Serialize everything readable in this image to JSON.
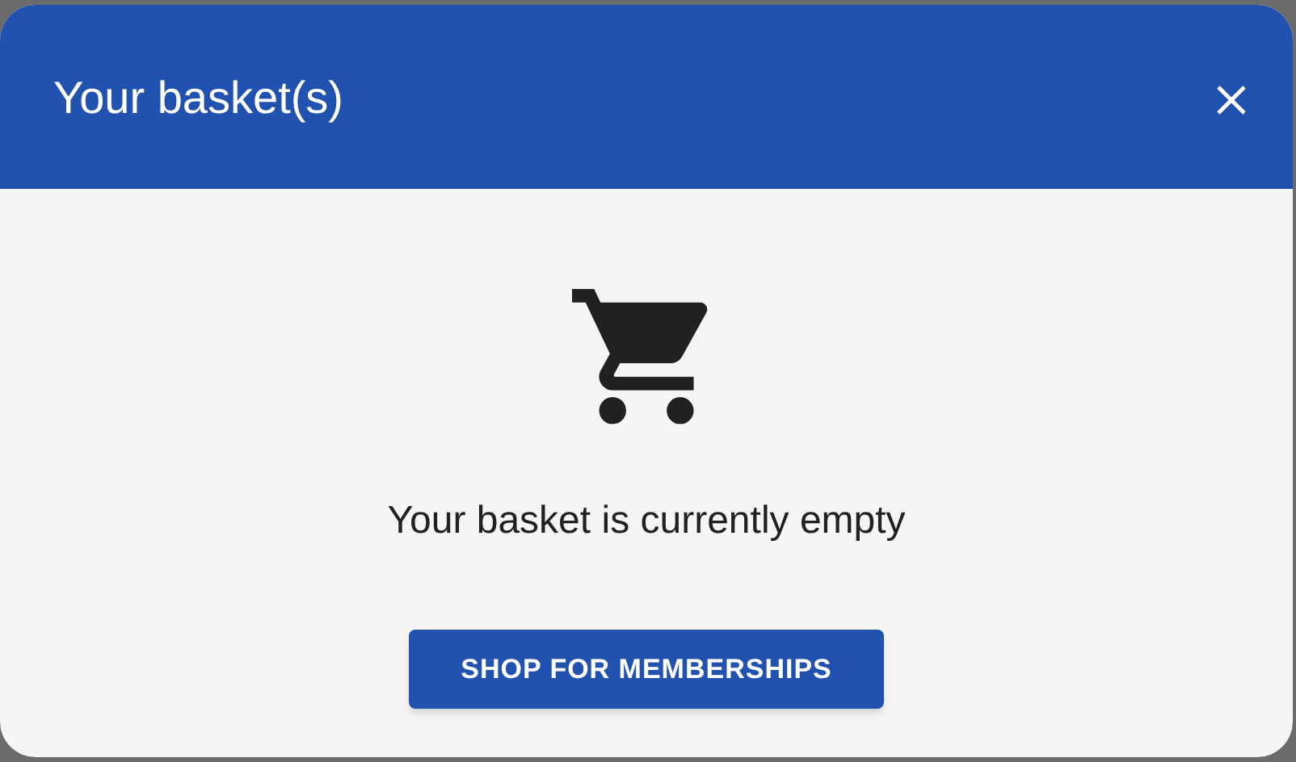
{
  "dialog": {
    "title": "Your basket(s)",
    "message": "Your basket is currently empty",
    "button": "SHOP FOR MEMBERSHIPS"
  }
}
